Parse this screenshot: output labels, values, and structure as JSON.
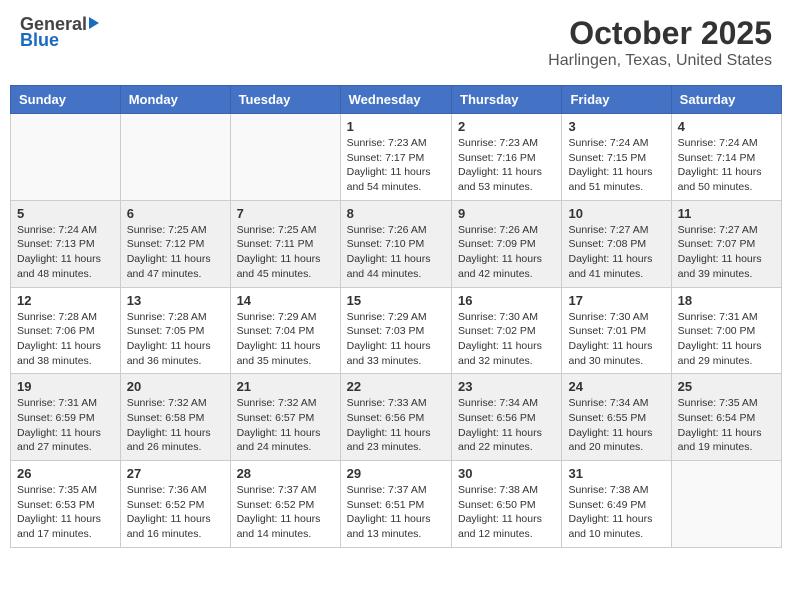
{
  "header": {
    "logo_general": "General",
    "logo_blue": "Blue",
    "title": "October 2025",
    "subtitle": "Harlingen, Texas, United States"
  },
  "calendar": {
    "days_of_week": [
      "Sunday",
      "Monday",
      "Tuesday",
      "Wednesday",
      "Thursday",
      "Friday",
      "Saturday"
    ],
    "weeks": [
      [
        {
          "day": "",
          "info": ""
        },
        {
          "day": "",
          "info": ""
        },
        {
          "day": "",
          "info": ""
        },
        {
          "day": "1",
          "info": "Sunrise: 7:23 AM\nSunset: 7:17 PM\nDaylight: 11 hours and 54 minutes."
        },
        {
          "day": "2",
          "info": "Sunrise: 7:23 AM\nSunset: 7:16 PM\nDaylight: 11 hours and 53 minutes."
        },
        {
          "day": "3",
          "info": "Sunrise: 7:24 AM\nSunset: 7:15 PM\nDaylight: 11 hours and 51 minutes."
        },
        {
          "day": "4",
          "info": "Sunrise: 7:24 AM\nSunset: 7:14 PM\nDaylight: 11 hours and 50 minutes."
        }
      ],
      [
        {
          "day": "5",
          "info": "Sunrise: 7:24 AM\nSunset: 7:13 PM\nDaylight: 11 hours and 48 minutes."
        },
        {
          "day": "6",
          "info": "Sunrise: 7:25 AM\nSunset: 7:12 PM\nDaylight: 11 hours and 47 minutes."
        },
        {
          "day": "7",
          "info": "Sunrise: 7:25 AM\nSunset: 7:11 PM\nDaylight: 11 hours and 45 minutes."
        },
        {
          "day": "8",
          "info": "Sunrise: 7:26 AM\nSunset: 7:10 PM\nDaylight: 11 hours and 44 minutes."
        },
        {
          "day": "9",
          "info": "Sunrise: 7:26 AM\nSunset: 7:09 PM\nDaylight: 11 hours and 42 minutes."
        },
        {
          "day": "10",
          "info": "Sunrise: 7:27 AM\nSunset: 7:08 PM\nDaylight: 11 hours and 41 minutes."
        },
        {
          "day": "11",
          "info": "Sunrise: 7:27 AM\nSunset: 7:07 PM\nDaylight: 11 hours and 39 minutes."
        }
      ],
      [
        {
          "day": "12",
          "info": "Sunrise: 7:28 AM\nSunset: 7:06 PM\nDaylight: 11 hours and 38 minutes."
        },
        {
          "day": "13",
          "info": "Sunrise: 7:28 AM\nSunset: 7:05 PM\nDaylight: 11 hours and 36 minutes."
        },
        {
          "day": "14",
          "info": "Sunrise: 7:29 AM\nSunset: 7:04 PM\nDaylight: 11 hours and 35 minutes."
        },
        {
          "day": "15",
          "info": "Sunrise: 7:29 AM\nSunset: 7:03 PM\nDaylight: 11 hours and 33 minutes."
        },
        {
          "day": "16",
          "info": "Sunrise: 7:30 AM\nSunset: 7:02 PM\nDaylight: 11 hours and 32 minutes."
        },
        {
          "day": "17",
          "info": "Sunrise: 7:30 AM\nSunset: 7:01 PM\nDaylight: 11 hours and 30 minutes."
        },
        {
          "day": "18",
          "info": "Sunrise: 7:31 AM\nSunset: 7:00 PM\nDaylight: 11 hours and 29 minutes."
        }
      ],
      [
        {
          "day": "19",
          "info": "Sunrise: 7:31 AM\nSunset: 6:59 PM\nDaylight: 11 hours and 27 minutes."
        },
        {
          "day": "20",
          "info": "Sunrise: 7:32 AM\nSunset: 6:58 PM\nDaylight: 11 hours and 26 minutes."
        },
        {
          "day": "21",
          "info": "Sunrise: 7:32 AM\nSunset: 6:57 PM\nDaylight: 11 hours and 24 minutes."
        },
        {
          "day": "22",
          "info": "Sunrise: 7:33 AM\nSunset: 6:56 PM\nDaylight: 11 hours and 23 minutes."
        },
        {
          "day": "23",
          "info": "Sunrise: 7:34 AM\nSunset: 6:56 PM\nDaylight: 11 hours and 22 minutes."
        },
        {
          "day": "24",
          "info": "Sunrise: 7:34 AM\nSunset: 6:55 PM\nDaylight: 11 hours and 20 minutes."
        },
        {
          "day": "25",
          "info": "Sunrise: 7:35 AM\nSunset: 6:54 PM\nDaylight: 11 hours and 19 minutes."
        }
      ],
      [
        {
          "day": "26",
          "info": "Sunrise: 7:35 AM\nSunset: 6:53 PM\nDaylight: 11 hours and 17 minutes."
        },
        {
          "day": "27",
          "info": "Sunrise: 7:36 AM\nSunset: 6:52 PM\nDaylight: 11 hours and 16 minutes."
        },
        {
          "day": "28",
          "info": "Sunrise: 7:37 AM\nSunset: 6:52 PM\nDaylight: 11 hours and 14 minutes."
        },
        {
          "day": "29",
          "info": "Sunrise: 7:37 AM\nSunset: 6:51 PM\nDaylight: 11 hours and 13 minutes."
        },
        {
          "day": "30",
          "info": "Sunrise: 7:38 AM\nSunset: 6:50 PM\nDaylight: 11 hours and 12 minutes."
        },
        {
          "day": "31",
          "info": "Sunrise: 7:38 AM\nSunset: 6:49 PM\nDaylight: 11 hours and 10 minutes."
        },
        {
          "day": "",
          "info": ""
        }
      ]
    ]
  }
}
